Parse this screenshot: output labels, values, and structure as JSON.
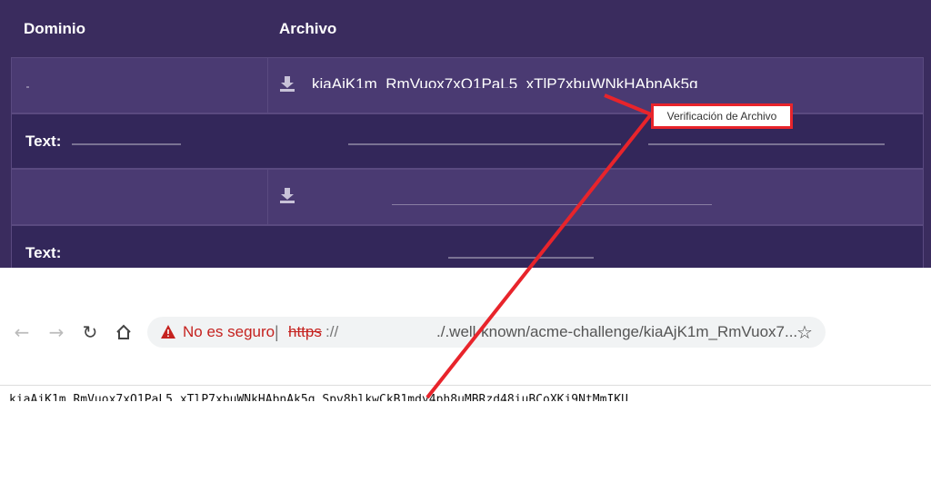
{
  "table": {
    "headers": {
      "domain": "Dominio",
      "file": "Archivo"
    },
    "rows": [
      {
        "file_name": "kiaAjK1m_RmVuox7xQ1PaL5_xTlP7xbuWNkHAbnAk5g"
      },
      {
        "label": "Text:"
      },
      {
        "file_name": ""
      },
      {
        "label": "Text:"
      }
    ]
  },
  "annotation": {
    "tooltip": "Verificación de Archivo",
    "highlight_color": "#e8242b"
  },
  "browser": {
    "back_icon": "arrow-left-icon",
    "forward_icon": "arrow-right-icon",
    "reload_icon": "reload-icon",
    "home_icon": "home-icon",
    "security_text": "No es seguro",
    "separator": "|",
    "scheme": "https",
    "scheme_suffix": "://",
    "url_rest": "./.well-known/acme-challenge/kiaAjK1m_RmVuox7...",
    "star_icon": "star-icon"
  },
  "page": {
    "content_text": "kiaAjK1m_RmVuox7xQ1PaL5_xTlP7xbuWNkHAbnAk5g.Spv8blkwCkB1mdy4ph8uMBRzd48iuBCoXKj9NtMmIKU"
  },
  "colors": {
    "panel_bg": "#3a2c5e",
    "row_alt": "#4a3a72",
    "insecure": "#c5221f"
  }
}
